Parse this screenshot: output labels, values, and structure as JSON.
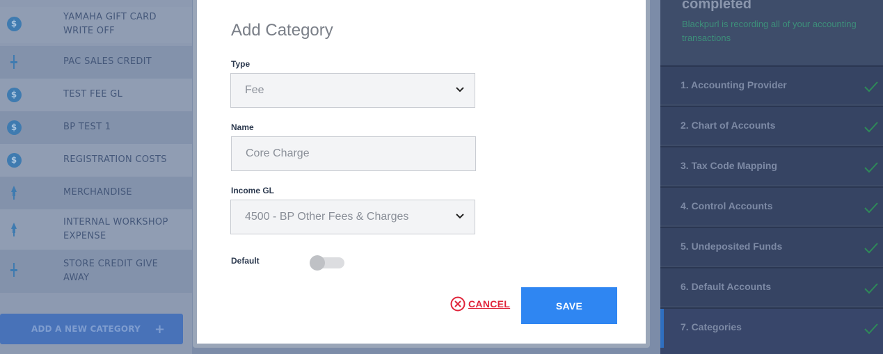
{
  "left_panel": {
    "categories": [
      {
        "label": "YAMAHA GIFT CARD WRITE OFF",
        "icon": "dollar-coin-icon"
      },
      {
        "label": "PAC SALES CREDIT",
        "icon": "pin-icon"
      },
      {
        "label": "TEST FEE GL",
        "icon": "dollar-coin-icon"
      },
      {
        "label": "BP TEST 1",
        "icon": "dollar-coin-icon"
      },
      {
        "label": "REGISTRATION COSTS",
        "icon": "dollar-coin-icon"
      },
      {
        "label": "MERCHANDISE",
        "icon": "tag-icon"
      },
      {
        "label": "INTERNAL WORKSHOP EXPENSE",
        "icon": "tag-icon"
      },
      {
        "label": "STORE CREDIT GIVE AWAY",
        "icon": "pin-icon"
      }
    ],
    "coin_symbol": "$",
    "add_button_label": "ADD A NEW CATEGORY",
    "add_button_plus": "+"
  },
  "modal": {
    "title": "Add Category",
    "type_label": "Type",
    "type_value": "Fee",
    "name_label": "Name",
    "name_placeholder": "Core Charge",
    "income_gl_label": "Income GL",
    "income_gl_value": "4500 - BP Other Fees & Charges",
    "default_label": "Default",
    "default_on": false,
    "cancel_label": "CANCEL",
    "save_label": "SAVE"
  },
  "right_panel": {
    "title": "completed",
    "subtitle": "Blackpurl is recording all of your accounting transactions",
    "steps": [
      {
        "label": "1. Accounting Provider",
        "done": true
      },
      {
        "label": "2. Chart of Accounts",
        "done": true
      },
      {
        "label": "3. Tax Code Mapping",
        "done": true
      },
      {
        "label": "4. Control Accounts",
        "done": true
      },
      {
        "label": "5. Undeposited Funds",
        "done": true
      },
      {
        "label": "6. Default Accounts",
        "done": true
      },
      {
        "label": "7. Categories",
        "done": true,
        "active": true
      }
    ]
  },
  "colors": {
    "accent_blue": "#2f86f2",
    "cancel_red": "#e0243a",
    "check_green": "#2e8a58"
  }
}
